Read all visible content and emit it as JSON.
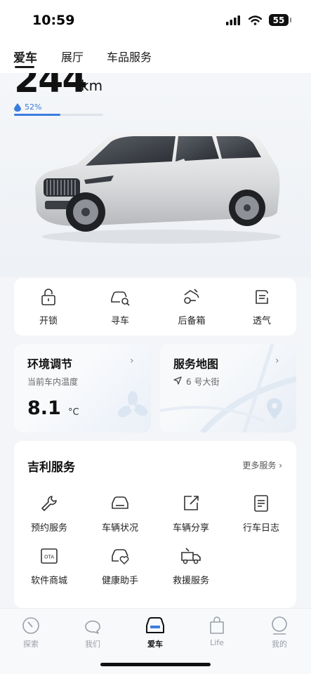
{
  "status_bar": {
    "time": "10:59",
    "battery": "55",
    "icons": [
      "signal-icon",
      "wifi-icon",
      "battery-icon"
    ]
  },
  "top_tabs": [
    {
      "label": "爱车",
      "active": true
    },
    {
      "label": "展厅",
      "active": false
    },
    {
      "label": "车品服务",
      "active": false
    }
  ],
  "vehicle": {
    "range_value": "244",
    "range_unit": "km",
    "battery_percent": "52%",
    "battery_fraction": 0.52,
    "accent_color": "#3b7ddd"
  },
  "quick_actions": [
    {
      "label": "开锁",
      "icon": "unlock-icon"
    },
    {
      "label": "寻车",
      "icon": "find-car-icon"
    },
    {
      "label": "后备箱",
      "icon": "trunk-icon"
    },
    {
      "label": "透气",
      "icon": "ventilate-icon"
    }
  ],
  "climate": {
    "title": "环境调节",
    "subtitle": "当前车内温度",
    "temperature": "8.1",
    "unit": "°C"
  },
  "service_map": {
    "title": "服务地图",
    "location": "6 号大街"
  },
  "geely_services": {
    "title": "吉利服务",
    "more_label": "更多服务",
    "items": [
      {
        "label": "预约服务",
        "icon": "wrench-icon"
      },
      {
        "label": "车辆状况",
        "icon": "car-status-icon"
      },
      {
        "label": "车辆分享",
        "icon": "share-icon"
      },
      {
        "label": "行车日志",
        "icon": "log-icon"
      },
      {
        "label": "软件商城",
        "icon": "ota-icon",
        "badge": "OTA"
      },
      {
        "label": "健康助手",
        "icon": "health-icon"
      },
      {
        "label": "救援服务",
        "icon": "rescue-truck-icon"
      }
    ]
  },
  "bottom_nav": [
    {
      "label": "探索",
      "icon": "explore-icon",
      "active": false
    },
    {
      "label": "我们",
      "icon": "community-icon",
      "active": false
    },
    {
      "label": "爱车",
      "icon": "car-icon",
      "active": true
    },
    {
      "label": "Life",
      "icon": "life-bag-icon",
      "active": false
    },
    {
      "label": "我的",
      "icon": "profile-icon",
      "active": false
    }
  ]
}
